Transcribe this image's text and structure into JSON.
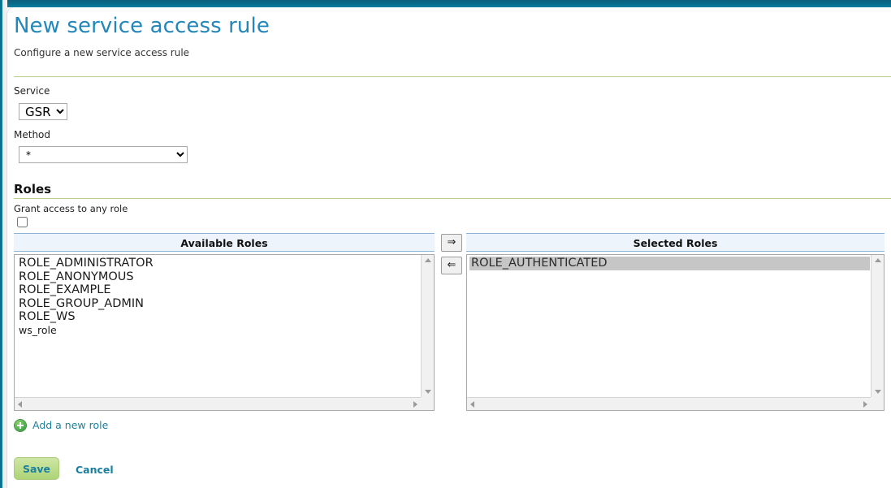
{
  "header": {
    "title": "New service access rule",
    "subtitle": "Configure a new service access rule"
  },
  "form": {
    "service": {
      "label": "Service",
      "value": "GSR",
      "options": [
        "GSR"
      ]
    },
    "method": {
      "label": "Method",
      "value": "*",
      "options": [
        "*"
      ]
    }
  },
  "roles": {
    "heading": "Roles",
    "grant_any_label": "Grant access to any role",
    "grant_any_checked": false,
    "available": {
      "header": "Available Roles",
      "items": [
        "ROLE_ADMINISTRATOR",
        "ROLE_ANONYMOUS",
        "ROLE_EXAMPLE",
        "ROLE_GROUP_ADMIN",
        "ROLE_WS",
        "ws_role"
      ]
    },
    "selected": {
      "header": "Selected Roles",
      "items": [
        "ROLE_AUTHENTICATED"
      ]
    },
    "transfer": {
      "to_selected": "⇒",
      "to_available": "⇐"
    },
    "add_new_role": "Add a new role"
  },
  "actions": {
    "save": "Save",
    "cancel": "Cancel"
  },
  "colors": {
    "accent_teal": "#1a7fa0",
    "title_blue": "#2288bb",
    "divider_green": "#b9cf8a",
    "save_green": "#bedd8d",
    "list_header_blue": "#eef4fb",
    "selection_gray": "#c6c6c6",
    "top_bar": "#0a6c8c"
  }
}
